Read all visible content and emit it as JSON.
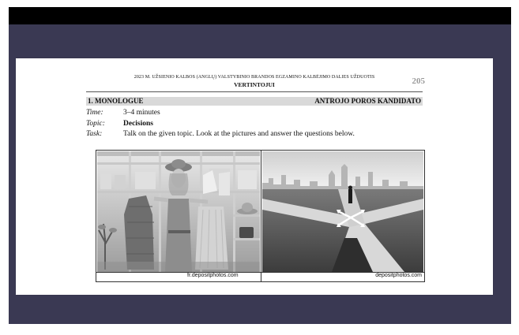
{
  "header": {
    "line": "2023 M. UŽSIENIO KALBOS (ANGLŲ) VALSTYBINIO BRANDOS EGZAMINO KALBĖJIMO DALIES UŽDUOTIS",
    "sub": "VERTINTOJUI",
    "page_number": "205"
  },
  "section": {
    "title": "1. MONOLOGUE",
    "right": "ANTROJO POROS KANDIDATO"
  },
  "rows": {
    "time_label": "Time:",
    "time_value": "3–4 minutes",
    "topic_label": "Topic:",
    "topic_value": "Decisions",
    "task_label": "Task:",
    "task_value": "Talk on the given topic. Look at the pictures and answer the questions below."
  },
  "images": {
    "left_caption": "fr.depositphotos.com",
    "right_caption": "depositphotos.com"
  },
  "colors": {
    "frame": "#3a3953",
    "topbar": "#000000",
    "section_bar": "#d9d9d9"
  }
}
